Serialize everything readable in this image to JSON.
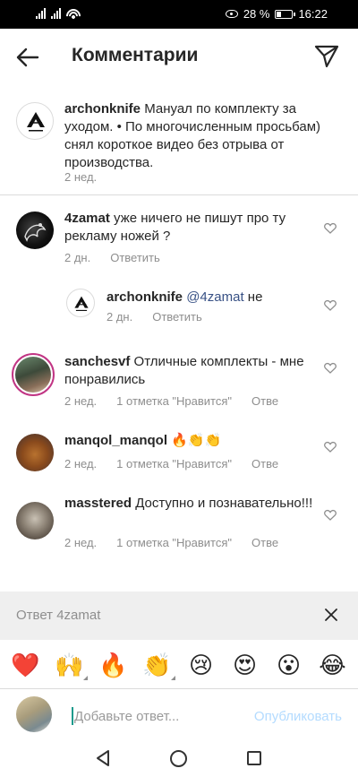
{
  "status_bar": {
    "battery": "28 %",
    "battery_level": 0.28,
    "time": "16:22"
  },
  "header": {
    "title": "Комментарии"
  },
  "caption": {
    "username": "archonknife",
    "text": "Мануал по комплекту за уходом. • По многочисленным просьбам) снял короткое видео без отрыва от производства.",
    "time": "2 нед."
  },
  "comments": [
    {
      "username": "4zamat",
      "text": "уже ничего не пишут про ту рекламу ножей ?",
      "time": "2 дн.",
      "likes": "",
      "reply": "Ответить"
    },
    {
      "username": "archonknife",
      "mention": "@4zamat",
      "text": "не",
      "time": "2 дн.",
      "likes": "",
      "reply": "Ответить"
    },
    {
      "username": "sanchesvf",
      "text": "Отличные комплекты - мне понравились",
      "time": "2 нед.",
      "likes": "1 отметка \"Нравится\"",
      "reply": "Ответить"
    },
    {
      "username": "manqol_manqol",
      "text": "🔥👏👏",
      "time": "2 нед.",
      "likes": "1 отметка \"Нравится\"",
      "reply": "Ответить"
    },
    {
      "username": "masstered",
      "text": "Доступно и познавательно!!!",
      "time": "2 нед.",
      "likes": "1 отметка \"Нравится\"",
      "reply": "Ответить"
    }
  ],
  "reply_bar": {
    "text": "Ответ 4zamat"
  },
  "emojis": [
    "❤️",
    "🙌",
    "🔥",
    "👏",
    "😢",
    "😍",
    "😮",
    "😂"
  ],
  "composer": {
    "placeholder": "Добавьте ответ...",
    "publish_label": "Опубликовать"
  },
  "colors": {
    "link": "#385185",
    "publish_disabled": "#b3dbff",
    "story_ring": "#c13584"
  }
}
